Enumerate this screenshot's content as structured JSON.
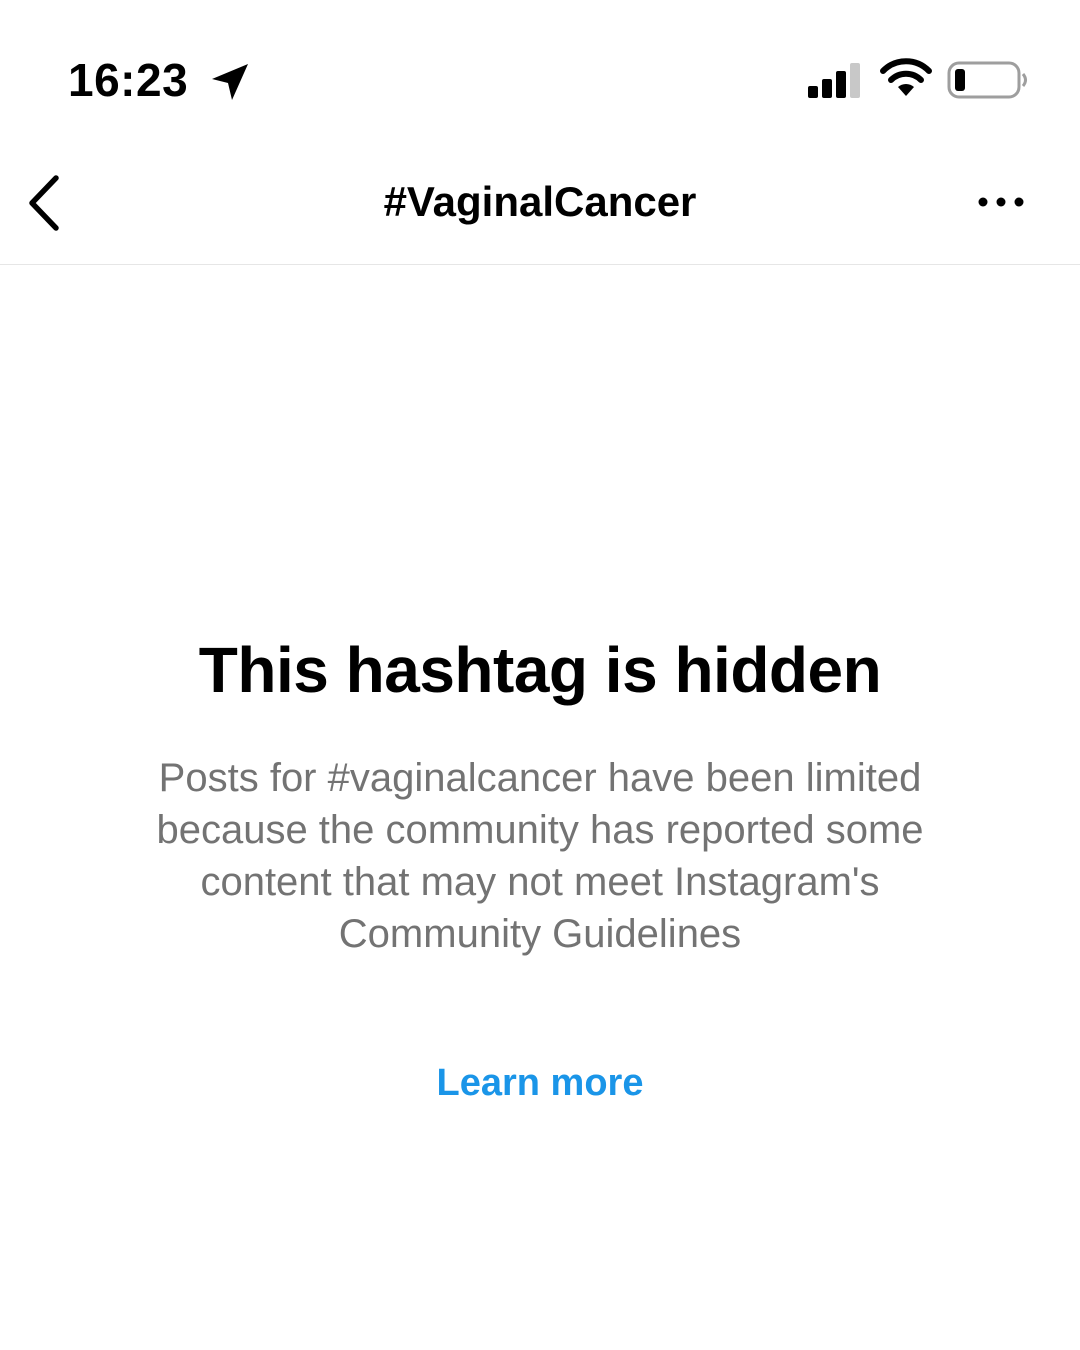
{
  "status_bar": {
    "time": "16:23",
    "icons": [
      "location-arrow-icon",
      "cellular-signal-icon",
      "wifi-icon",
      "battery-low-icon"
    ]
  },
  "header": {
    "title": "#VaginalCancer",
    "back_icon": "chevron-left-icon",
    "more_icon": "more-horizontal-icon"
  },
  "main": {
    "heading": "This hashtag is hidden",
    "message": "Posts for #vaginalcancer have been limited because the community has reported some content that may not meet Instagram's Community Guidelines",
    "learn_more_label": "Learn more"
  },
  "colors": {
    "link": "#1a95e8",
    "secondary_text": "#737373",
    "divider": "#e6e6e6"
  }
}
